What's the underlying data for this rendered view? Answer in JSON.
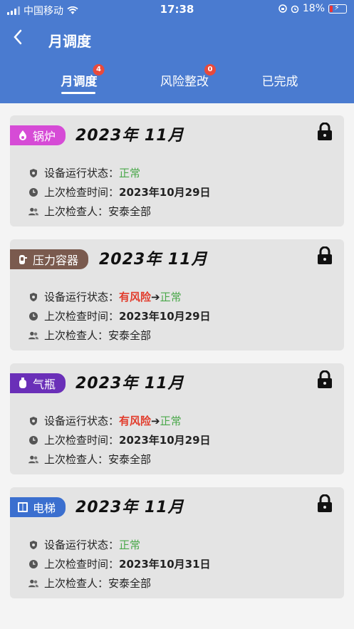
{
  "status_bar": {
    "carrier": "中国移动",
    "time": "17:38",
    "battery": "18%"
  },
  "header": {
    "title": "月调度"
  },
  "tabs": [
    {
      "label": "月调度",
      "badge": "4"
    },
    {
      "label": "风险整改",
      "badge": "0"
    },
    {
      "label": "已完成"
    }
  ],
  "labels": {
    "status": "设备运行状态：",
    "last_check_time": "上次检查时间：",
    "last_checker": "上次检查人："
  },
  "cards": [
    {
      "tag": "锅炉",
      "tag_color": "#d64bd6",
      "date": "2023年 11月",
      "status_normal": "正常",
      "last_check": "2023年10月29日",
      "checker": "安泰全部"
    },
    {
      "tag": "压力容器",
      "tag_color": "#7a5a4e",
      "date": "2023年 11月",
      "status_risk": "有风险",
      "arrow": "➔",
      "status_normal": "正常",
      "last_check": "2023年10月29日",
      "checker": "安泰全部"
    },
    {
      "tag": "气瓶",
      "tag_color": "#6a2fb8",
      "date": "2023年 11月",
      "status_risk": "有风险",
      "arrow": "➔",
      "status_normal": "正常",
      "last_check": "2023年10月29日",
      "checker": "安泰全部"
    },
    {
      "tag": "电梯",
      "tag_color": "#3b6fcf",
      "date": "2023年 11月",
      "status_normal": "正常",
      "last_check": "2023年10月31日",
      "checker": "安泰全部"
    }
  ]
}
